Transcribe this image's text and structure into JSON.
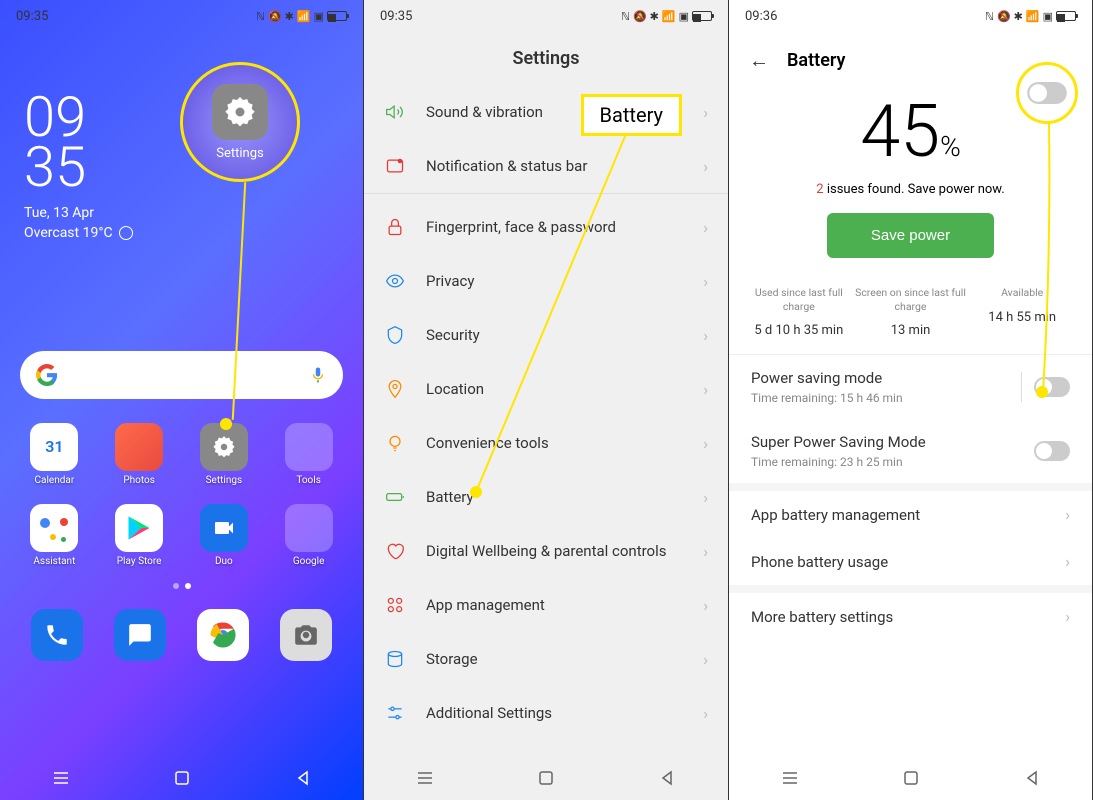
{
  "panel1": {
    "time": "09:35",
    "clock_h": "09",
    "clock_m": "35",
    "date": "Tue, 13 Apr",
    "weather": "Overcast 19°C",
    "callout_label": "Settings",
    "apps": [
      {
        "label": "Calendar"
      },
      {
        "label": "Photos"
      },
      {
        "label": "Settings"
      },
      {
        "label": "Tools"
      },
      {
        "label": "Assistant"
      },
      {
        "label": "Play Store"
      },
      {
        "label": "Duo"
      },
      {
        "label": "Google"
      }
    ]
  },
  "panel2": {
    "time": "09:35",
    "title": "Settings",
    "callout": "Battery",
    "items": [
      {
        "label": "Sound & vibration"
      },
      {
        "label": "Notification & status bar"
      },
      {
        "label": "Fingerprint, face & password"
      },
      {
        "label": "Privacy"
      },
      {
        "label": "Security"
      },
      {
        "label": "Location"
      },
      {
        "label": "Convenience tools"
      },
      {
        "label": "Battery"
      },
      {
        "label": "Digital Wellbeing & parental controls"
      },
      {
        "label": "App management"
      },
      {
        "label": "Storage"
      },
      {
        "label": "Additional Settings"
      }
    ]
  },
  "panel3": {
    "time": "09:36",
    "title": "Battery",
    "percent": "45",
    "percent_sym": "%",
    "issues_count": "2",
    "issues_text": " issues found. Save power now.",
    "save_btn": "Save power",
    "stats": [
      {
        "label": "Used since last full charge",
        "value": "5 d 10 h 35 min"
      },
      {
        "label": "Screen on since last full charge",
        "value": "13 min"
      },
      {
        "label": "Available",
        "value": "14 h 55 min"
      }
    ],
    "modes": [
      {
        "title": "Power saving mode",
        "sub": "Time remaining:  15 h 46 min"
      },
      {
        "title": "Super Power Saving Mode",
        "sub": "Time remaining:  23 h 25 min"
      }
    ],
    "links": [
      {
        "title": "App battery management"
      },
      {
        "title": "Phone battery usage"
      },
      {
        "title": "More battery settings"
      }
    ]
  }
}
